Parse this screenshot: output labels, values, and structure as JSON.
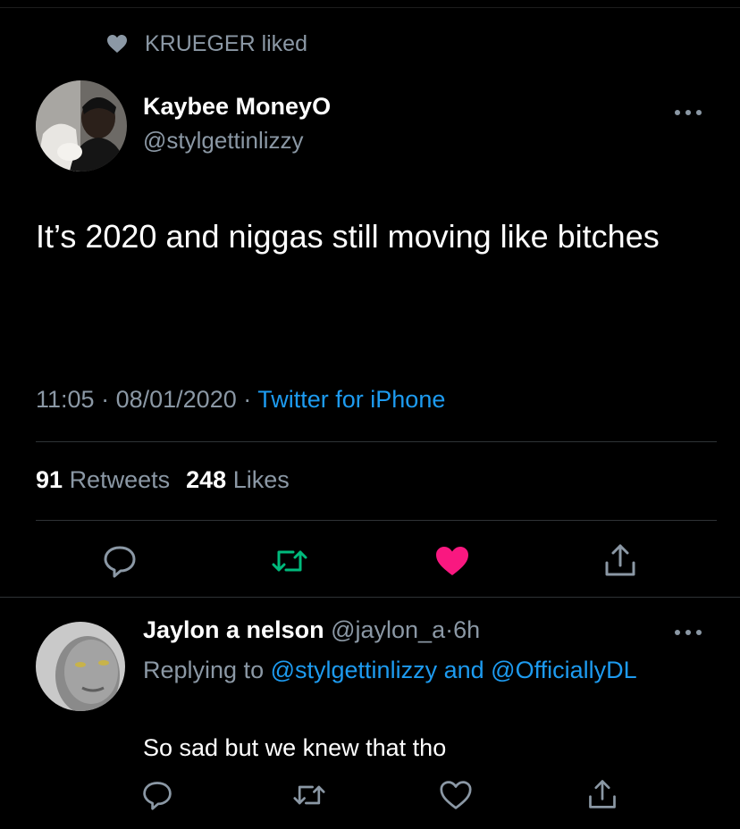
{
  "social_context": {
    "text": "KRUEGER liked",
    "icon": "heart-icon"
  },
  "tweet": {
    "author_name": "Kaybee MoneyO",
    "author_handle": "@stylgettinlizzy",
    "text": "It’s 2020 and niggas still moving like bitches",
    "time": "11:05",
    "date": "08/01/2020",
    "separator": "·",
    "source": "Twitter for iPhone",
    "retweets_count": "91",
    "retweets_label": "Retweets",
    "likes_count": "248",
    "likes_label": "Likes",
    "liked": true
  },
  "reply": {
    "author_name": "Jaylon a nelson",
    "author_handle": "@jaylon_a",
    "separator": "·",
    "age": "6h",
    "replying_prefix": "Replying to",
    "mention1": "@stylgettinlizzy",
    "and_word": "and",
    "mention2": "@OfficiallyDL",
    "text": "So sad but we knew that tho",
    "liked": false
  },
  "colors": {
    "background": "#000000",
    "secondary_text": "#8b98a5",
    "link": "#1d9bf0",
    "retweet_green": "#00ba7c",
    "like_red": "#f91880"
  }
}
